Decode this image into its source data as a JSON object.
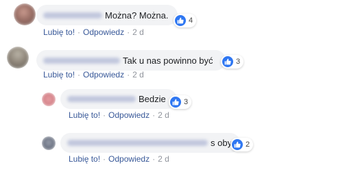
{
  "comments": [
    {
      "text": "Można? Można.",
      "reaction_count": "4",
      "like_label": "Lubię to!",
      "reply_label": "Odpowiedz",
      "time": "2 d"
    },
    {
      "text": "Tak u nas powinno być",
      "reaction_count": "3",
      "like_label": "Lubię to!",
      "reply_label": "Odpowiedz",
      "time": "2 d"
    },
    {
      "text": "Bedzie",
      "reaction_count": "3",
      "like_label": "Lubię to!",
      "reply_label": "Odpowiedz",
      "time": "2 d"
    },
    {
      "text": "s oby",
      "reaction_count": "2",
      "like_label": "Lubię to!",
      "reply_label": "Odpowiedz",
      "time": "2 d"
    }
  ],
  "icons": {
    "reaction": "thumbs-up-icon"
  },
  "colors": {
    "bubble": "#f2f3f5",
    "link": "#385898",
    "meta": "#90949c",
    "like": "#2f77f2"
  }
}
